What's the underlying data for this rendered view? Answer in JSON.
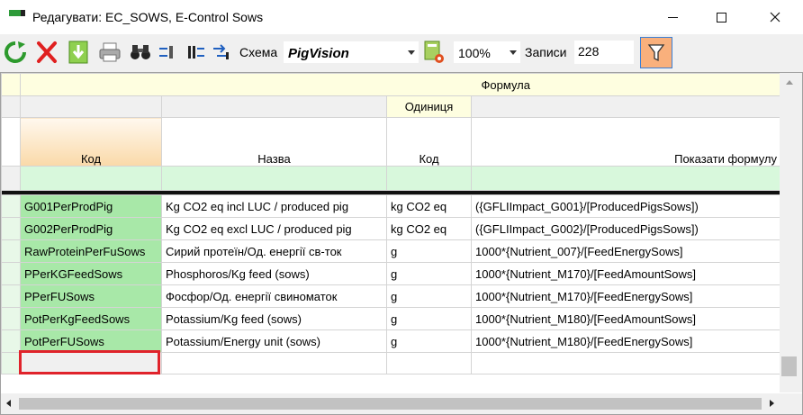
{
  "window": {
    "title": "Редагувати: EC_SOWS, E-Control Sows"
  },
  "toolbar": {
    "schema_label": "Схема",
    "schema_value": "PigVision",
    "zoom_value": "100%",
    "records_label": "Записи",
    "records_value": "228",
    "icons": [
      "refresh-icon",
      "delete-icon",
      "download-icon",
      "print-icon",
      "binoculars-icon",
      "import-icon",
      "export-icon",
      "swap-icon",
      "schema-settings-icon",
      "filter-icon"
    ]
  },
  "grid": {
    "band_header": "Формула",
    "unit_header": "Одиниця",
    "columns": [
      "Код",
      "Назва",
      "Код",
      "Показати формулу"
    ],
    "rows": [
      [
        "G001PerProdPig",
        "Kg CO2 eq incl LUC / produced pig",
        "kg CO2 eq",
        "({GFLIImpact_G001}/[ProducedPigsSows])"
      ],
      [
        "G002PerProdPig",
        "Kg CO2 eq excl LUC / produced pig",
        "kg CO2 eq",
        "({GFLIImpact_G002}/[ProducedPigsSows])"
      ],
      [
        "RawProteinPerFuSows",
        "Сирий протеїн/Од. енергії св-ток",
        "g",
        "1000*{Nutrient_007}/[FeedEnergySows]"
      ],
      [
        "PPerKGFeedSows",
        "Phosphoros/Kg feed (sows)",
        "g",
        "1000*{Nutrient_M170}/[FeedAmountSows]"
      ],
      [
        "PPerFUSows",
        "Фосфор/Од. енергії свиноматок",
        "g",
        "1000*{Nutrient_M170}/[FeedEnergySows]"
      ],
      [
        "PotPerKgFeedSows",
        "Potassium/Kg feed (sows)",
        "g",
        "1000*{Nutrient_M180}/[FeedAmountSows]"
      ],
      [
        "PotPerFUSows",
        "Potassium/Energy unit (sows)",
        "g",
        "1000*{Nutrient_M180}/[FeedEnergySows]"
      ]
    ]
  },
  "colors": {
    "code_cell": "#a8e8a8",
    "filter_row": "#d8f8dc",
    "band": "#fefee0",
    "active_header": "#fad9a8",
    "highlight": "#e0232b"
  }
}
